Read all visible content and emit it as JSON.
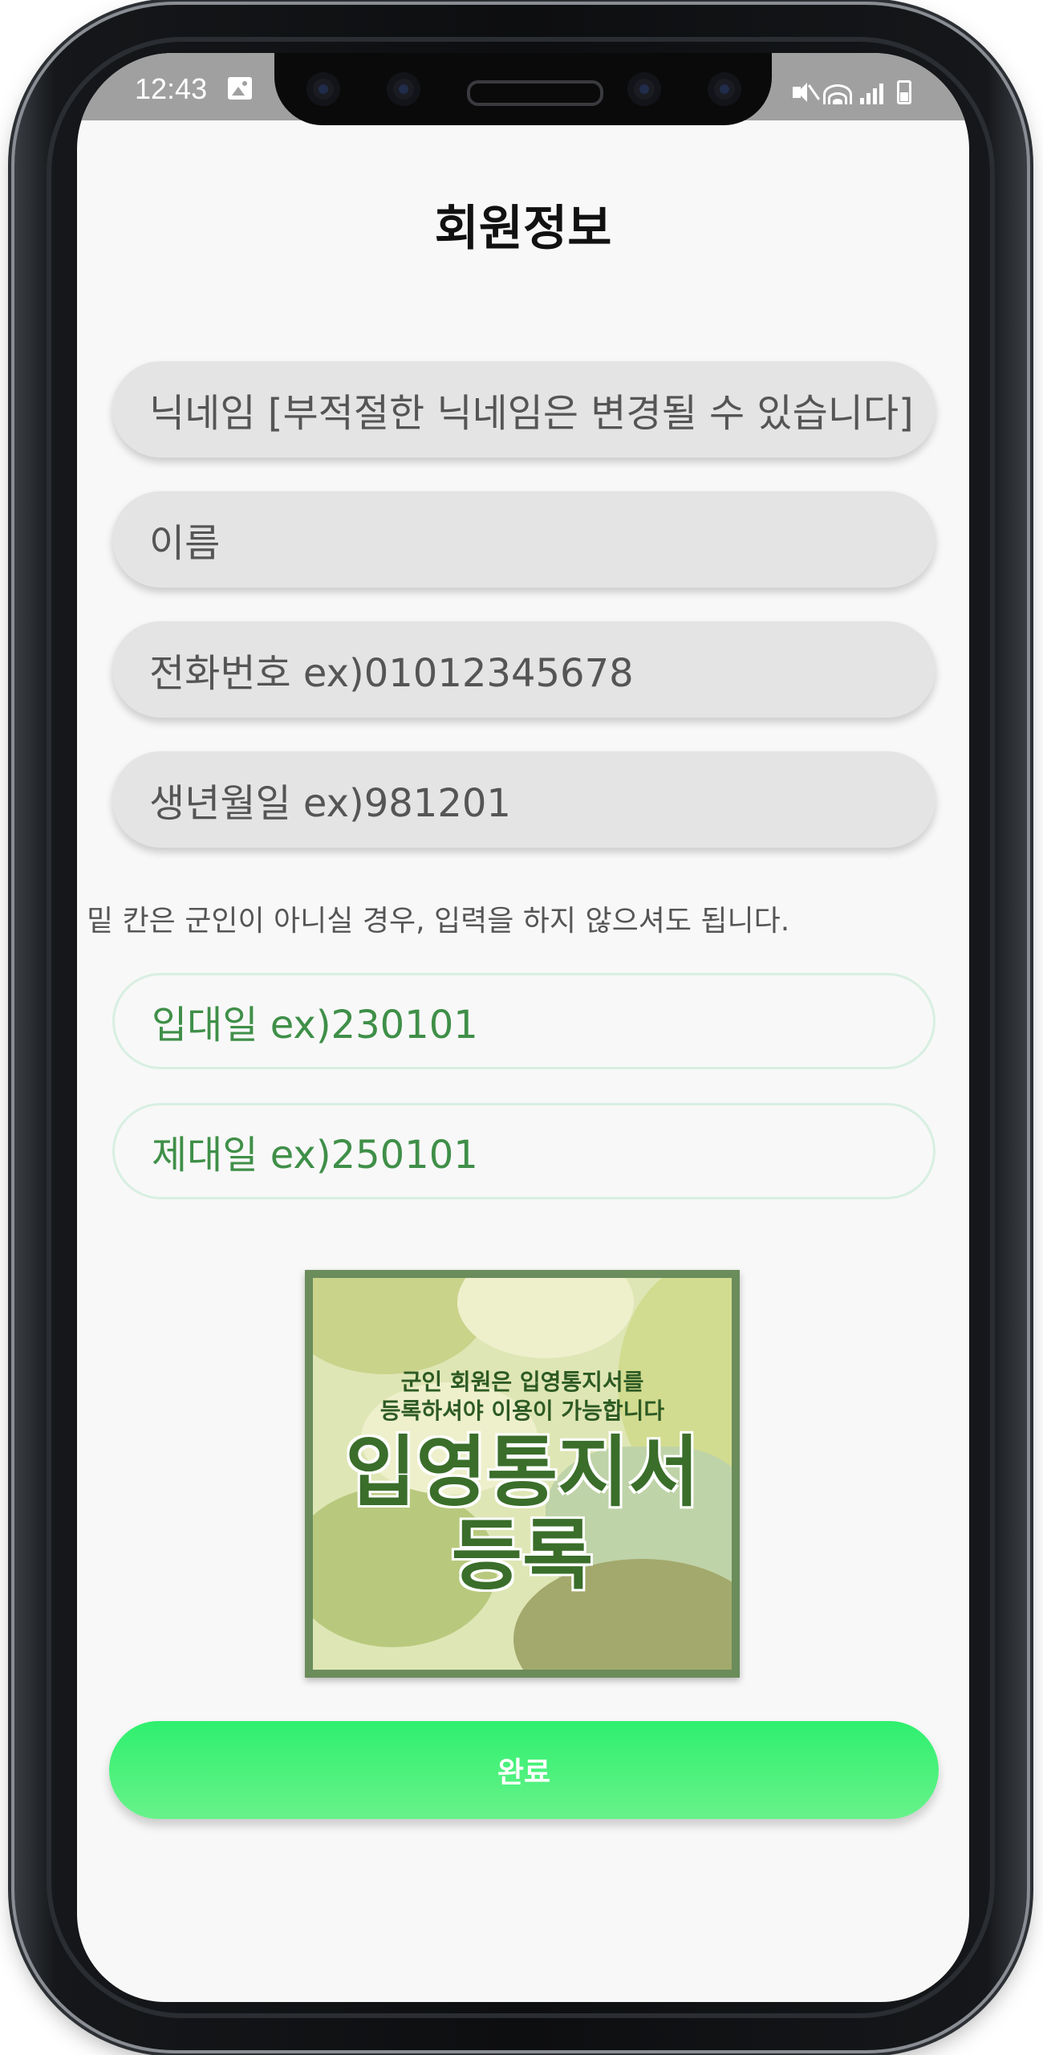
{
  "status_bar": {
    "time": "12:43",
    "icons": [
      "image-icon",
      "mute-icon",
      "wifi-icon",
      "signal-icon",
      "battery-icon"
    ]
  },
  "page": {
    "title": "회원정보"
  },
  "form": {
    "nickname_placeholder": "닉네임 [부적절한 닉네임은 변경될 수 있습니다]",
    "name_placeholder": "이름",
    "phone_placeholder": "전화번호 ex)01012345678",
    "birth_placeholder": "생년월일 ex)981201",
    "military_note": "밑 칸은 군인이 아니실 경우, 입력을 하지 않으셔도 됩니다.",
    "enlist_placeholder": "입대일 ex)230101",
    "discharge_placeholder": "제대일 ex)250101"
  },
  "poster": {
    "line1": "군인 회원은 입영통지서를",
    "line2": "등록하셔야 이용이 가능합니다",
    "big_line1": "입영통지서",
    "big_line2": "등록"
  },
  "submit_label": "완료",
  "colors": {
    "field_gray": "#e4e4e4",
    "outline_green": "#d8efe2",
    "placeholder_green": "#3f8f48",
    "button_green": "#2ef06e",
    "poster_border": "#6b8c5b"
  }
}
